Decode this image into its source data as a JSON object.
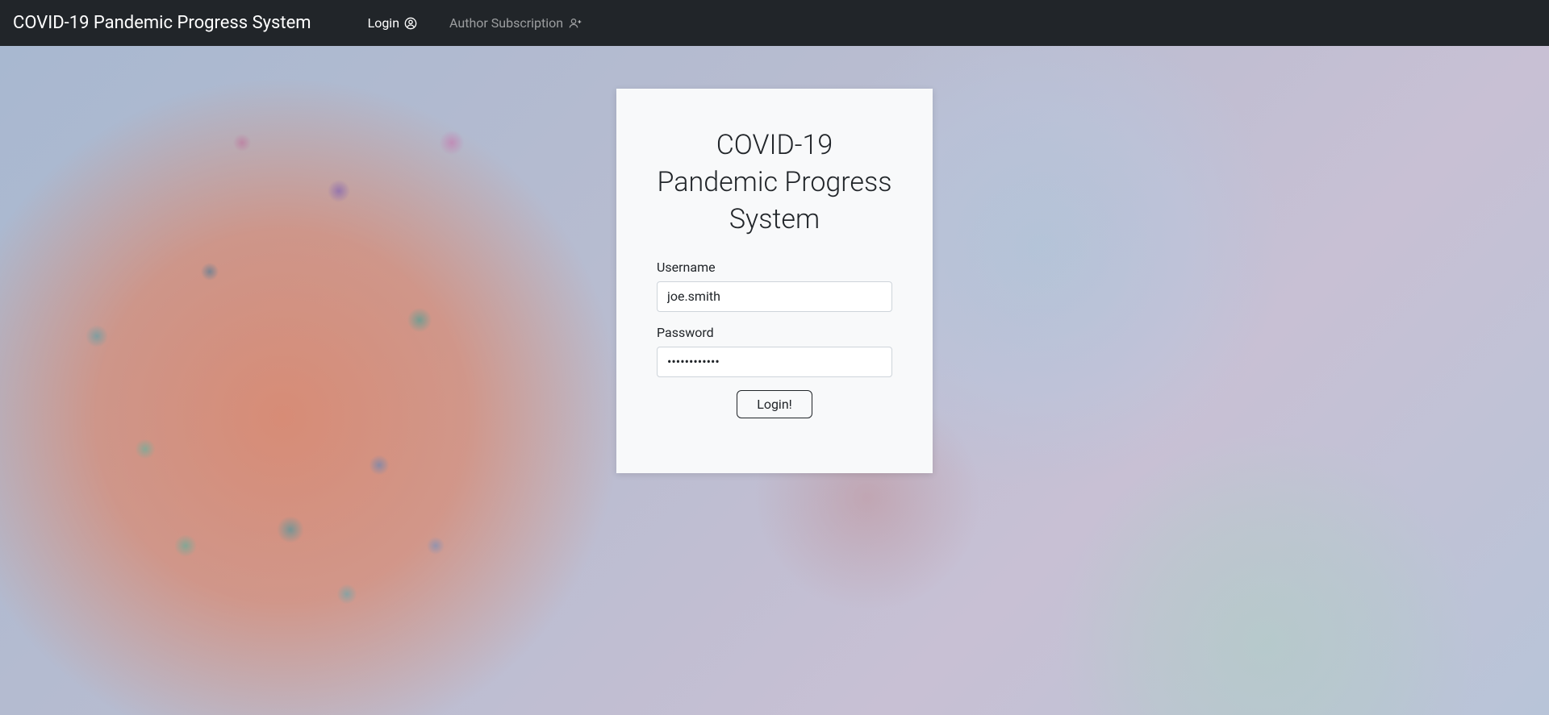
{
  "navbar": {
    "brand": "COVID-19 Pandemic Progress System",
    "login_label": "Login",
    "author_sub_label": "Author Subscription"
  },
  "login": {
    "title": "COVID-19 Pandemic Progress System",
    "username_label": "Username",
    "username_value": "joe.smith",
    "password_label": "Password",
    "password_value": "••••••••••••",
    "button_label": "Login!"
  }
}
